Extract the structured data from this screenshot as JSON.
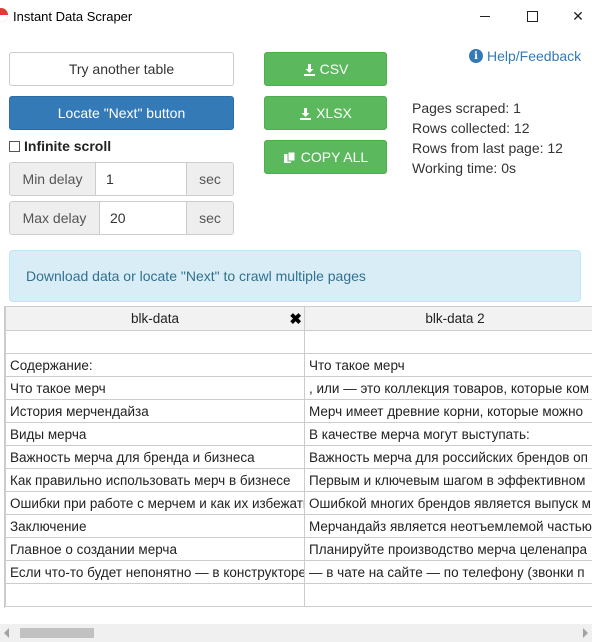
{
  "window": {
    "title": "Instant Data Scraper",
    "minimize_symbol": "—",
    "maximize_symbol": "☐",
    "close_symbol": "✕"
  },
  "controls": {
    "try_another_label": "Try another table",
    "locate_next_label": "Locate \"Next\" button",
    "infinite_scroll_label": "Infinite scroll",
    "infinite_scroll_checked": false,
    "min_delay": {
      "label": "Min delay",
      "value": "1",
      "unit": "sec"
    },
    "max_delay": {
      "label": "Max delay",
      "value": "20",
      "unit": "sec"
    }
  },
  "export": {
    "csv_label": "CSV",
    "xlsx_label": "XLSX",
    "copy_all_label": "COPY ALL"
  },
  "help": {
    "label": "Help/Feedback"
  },
  "stats": {
    "pages_scraped": "Pages scraped: 1",
    "rows_collected": "Rows collected: 12",
    "rows_from_last_page": "Rows from last page: 12",
    "working_time": "Working time: 0s"
  },
  "alert": {
    "text": "Download data or locate \"Next\" to crawl multiple pages"
  },
  "table": {
    "headers": [
      "blk-data",
      "blk-data 2"
    ],
    "rows": [
      [
        "",
        ""
      ],
      [
        "Содержание:",
        "Что такое мерч"
      ],
      [
        "Что такое мерч",
        ", или — это коллекция товаров, которые ком"
      ],
      [
        "История мерчендайза",
        "Мерч имеет древние корни, которые можно"
      ],
      [
        "Виды мерча",
        "В качестве мерча могут выступать:"
      ],
      [
        "Важность мерча для бренда и бизнеса",
        "Важность мерча для российских брендов оп"
      ],
      [
        "Как правильно использовать мерч в бизнесе",
        "Первым и ключевым шагом в эффективном"
      ],
      [
        "Ошибки при работе с мерчем и как их избежать",
        "Ошибкой многих брендов является выпуск м"
      ],
      [
        "Заключение",
        "Мерчандайз является неотъемлемой частью"
      ],
      [
        "Главное о создании мерча",
        "Планируйте производство мерча целенапра"
      ],
      [
        "Если что-то будет непонятно — в конструкторе",
        "— в чате на сайте — по телефону (звонки п"
      ],
      [
        "",
        ""
      ]
    ]
  }
}
